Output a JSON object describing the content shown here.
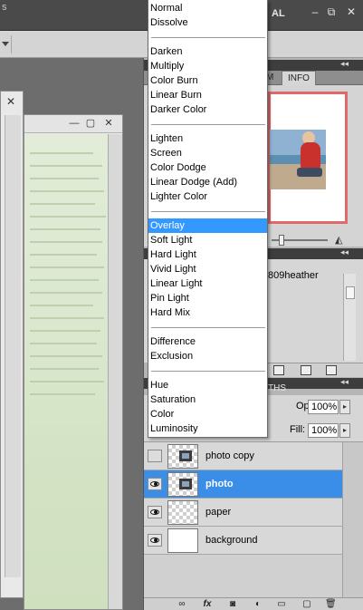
{
  "app": {
    "title_fragment": "s",
    "workspace_label": "AL"
  },
  "navigator": {
    "tabs": [
      "M",
      "INFO"
    ]
  },
  "history": {
    "item": "809heather"
  },
  "layers": {
    "tab_fragment": "THS",
    "opacity_label": "Opacity:",
    "opacity_value": "100%",
    "fill_label": "Fill:",
    "fill_value": "100%",
    "rows": [
      {
        "name": "photo copy",
        "visible": false,
        "selected": false
      },
      {
        "name": "photo",
        "visible": true,
        "selected": true
      },
      {
        "name": "paper",
        "visible": true,
        "selected": false
      },
      {
        "name": "background",
        "visible": true,
        "selected": false
      }
    ],
    "footer_icons": [
      "link-icon",
      "fx-icon",
      "mask-icon",
      "adjustment-icon",
      "folder-icon",
      "new-layer-icon",
      "trash-icon"
    ]
  },
  "blend_menu": {
    "selected": "Overlay",
    "groups": [
      [
        "Normal",
        "Dissolve"
      ],
      [
        "Darken",
        "Multiply",
        "Color Burn",
        "Linear Burn",
        "Darker Color"
      ],
      [
        "Lighten",
        "Screen",
        "Color Dodge",
        "Linear Dodge (Add)",
        "Lighter Color"
      ],
      [
        "Overlay",
        "Soft Light",
        "Hard Light",
        "Vivid Light",
        "Linear Light",
        "Pin Light",
        "Hard Mix"
      ],
      [
        "Difference",
        "Exclusion"
      ],
      [
        "Hue",
        "Saturation",
        "Color",
        "Luminosity"
      ]
    ]
  },
  "colors": {
    "selection": "#3399ff",
    "layer_selected": "#3a8ee8",
    "nav_frame": "#e06a6a"
  }
}
